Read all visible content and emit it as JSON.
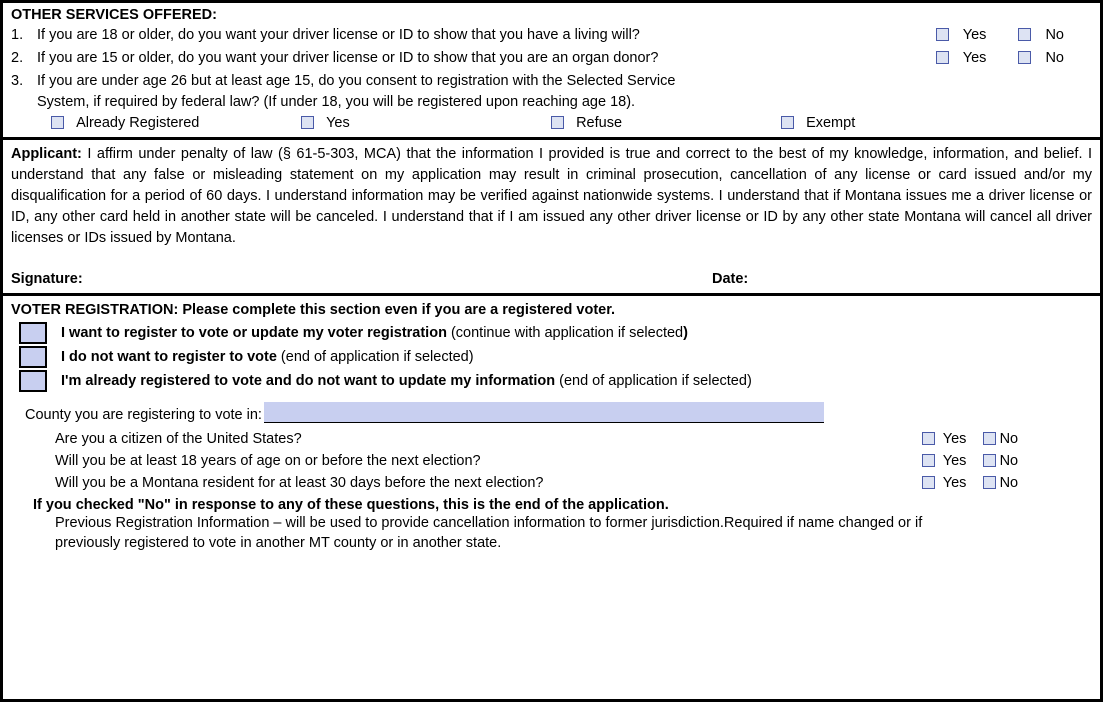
{
  "services": {
    "heading": "OTHER SERVICES OFFERED:",
    "q1_num": "1.",
    "q1": "If you are 18 or older, do you want your driver license or ID to show that you have a living will?",
    "q2_num": "2.",
    "q2": "If you are 15 or older, do you want your driver license or ID to show that you are an organ donor?",
    "q3_num": "3.",
    "q3a": "If you are under age 26 but at least age 15, do you consent to registration with the Selected Service",
    "q3b": "System, if required by federal law? (If under 18, you will be registered upon reaching age 18).",
    "opt1": "Already Registered",
    "opt2": "Yes",
    "opt3": "Refuse",
    "opt4": "Exempt",
    "yes": "Yes",
    "no": "No"
  },
  "affirm": {
    "label": "Applicant:",
    "text": " I affirm under penalty of law (§ 61-5-303, MCA) that the information I provided is true and correct to the best of my knowledge, information, and belief. I understand that any false or misleading statement on my application may result in criminal prosecution, cancellation of any license or card issued and/or my disqualification for a period of 60 days. I understand information may be verified against nationwide systems. I understand that if Montana issues me a driver license or ID, any other card held in another state will be canceled. I understand that if I am issued any other driver license or ID by any other state Montana will cancel all driver licenses or IDs issued by Montana.",
    "signature": "Signature:",
    "date": "Date:"
  },
  "voter": {
    "heading": "VOTER  REGISTRATION: Please complete this section even if you are a registered voter.",
    "opt1a": "I want to register to vote or update my voter registration ",
    "opt1b": "(continue with application if selected",
    "opt1c": ")",
    "opt2a": "I do not want to register to vote ",
    "opt2b": "(end of application if selected)",
    "opt3a": "I'm already registered to vote and do not want to update my information ",
    "opt3b": "(end of application if selected)",
    "county": "County you are registering to vote in:",
    "eq1": "Are you a citizen of the United States?",
    "eq2": "Will you be at least 18 years of age on or before the next election?",
    "eq3": "Will you be a Montana resident for at least 30 days before the next election?",
    "yes": "Yes",
    "no": "No",
    "noend": "If you checked \"No\" in response to any of these questions, this is the end of the application.",
    "prev": "Previous Registration Information – will be used to provide cancellation information to former jurisdiction.Required if name changed or if previously registered to vote in another MT county or in another state."
  }
}
